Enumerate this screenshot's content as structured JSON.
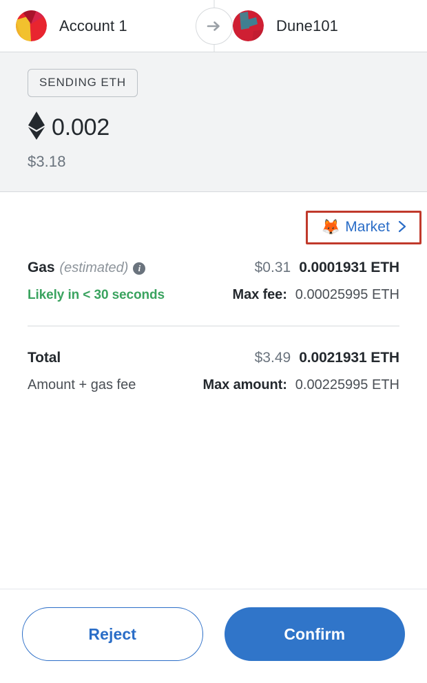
{
  "header": {
    "from": {
      "name": "Account 1",
      "avatar_name": "jazzicon-account-1",
      "avatar_colors": [
        "#e23b3b",
        "#f0b429",
        "#a61b2b",
        "#d6254a"
      ]
    },
    "to": {
      "name": "Dune101",
      "avatar_name": "jazzicon-dune101",
      "avatar_colors": [
        "#cf2233",
        "#4a7f8c",
        "#3f7f92",
        "#b01e2e"
      ]
    },
    "arrow_icon": "arrow-right-icon"
  },
  "sending": {
    "badge": "SENDING ETH",
    "token_icon": "ethereum-diamond-icon",
    "amount": "0.002",
    "fiat": "$3.18"
  },
  "market": {
    "icon": "fox-icon",
    "emoji": "🦊",
    "label": "Market",
    "chevron_icon": "chevron-right-icon",
    "highlight_color": "#c0392b"
  },
  "gas": {
    "label": "Gas",
    "estimated_note": "(estimated)",
    "info_icon": "info-icon",
    "info_glyph": "i",
    "fiat": "$0.31",
    "eth": "0.0001931 ETH",
    "speed_text": "Likely in < 30 seconds",
    "speed_color": "#3aa35f",
    "max_fee_label": "Max fee:",
    "max_fee_value": "0.00025995 ETH"
  },
  "total": {
    "label": "Total",
    "fiat": "$3.49",
    "eth": "0.0021931 ETH",
    "sub_label": "Amount + gas fee",
    "max_amount_label": "Max amount:",
    "max_amount_value": "0.00225995 ETH"
  },
  "footer": {
    "reject_label": "Reject",
    "confirm_label": "Confirm",
    "accent_color": "#3075c9"
  }
}
